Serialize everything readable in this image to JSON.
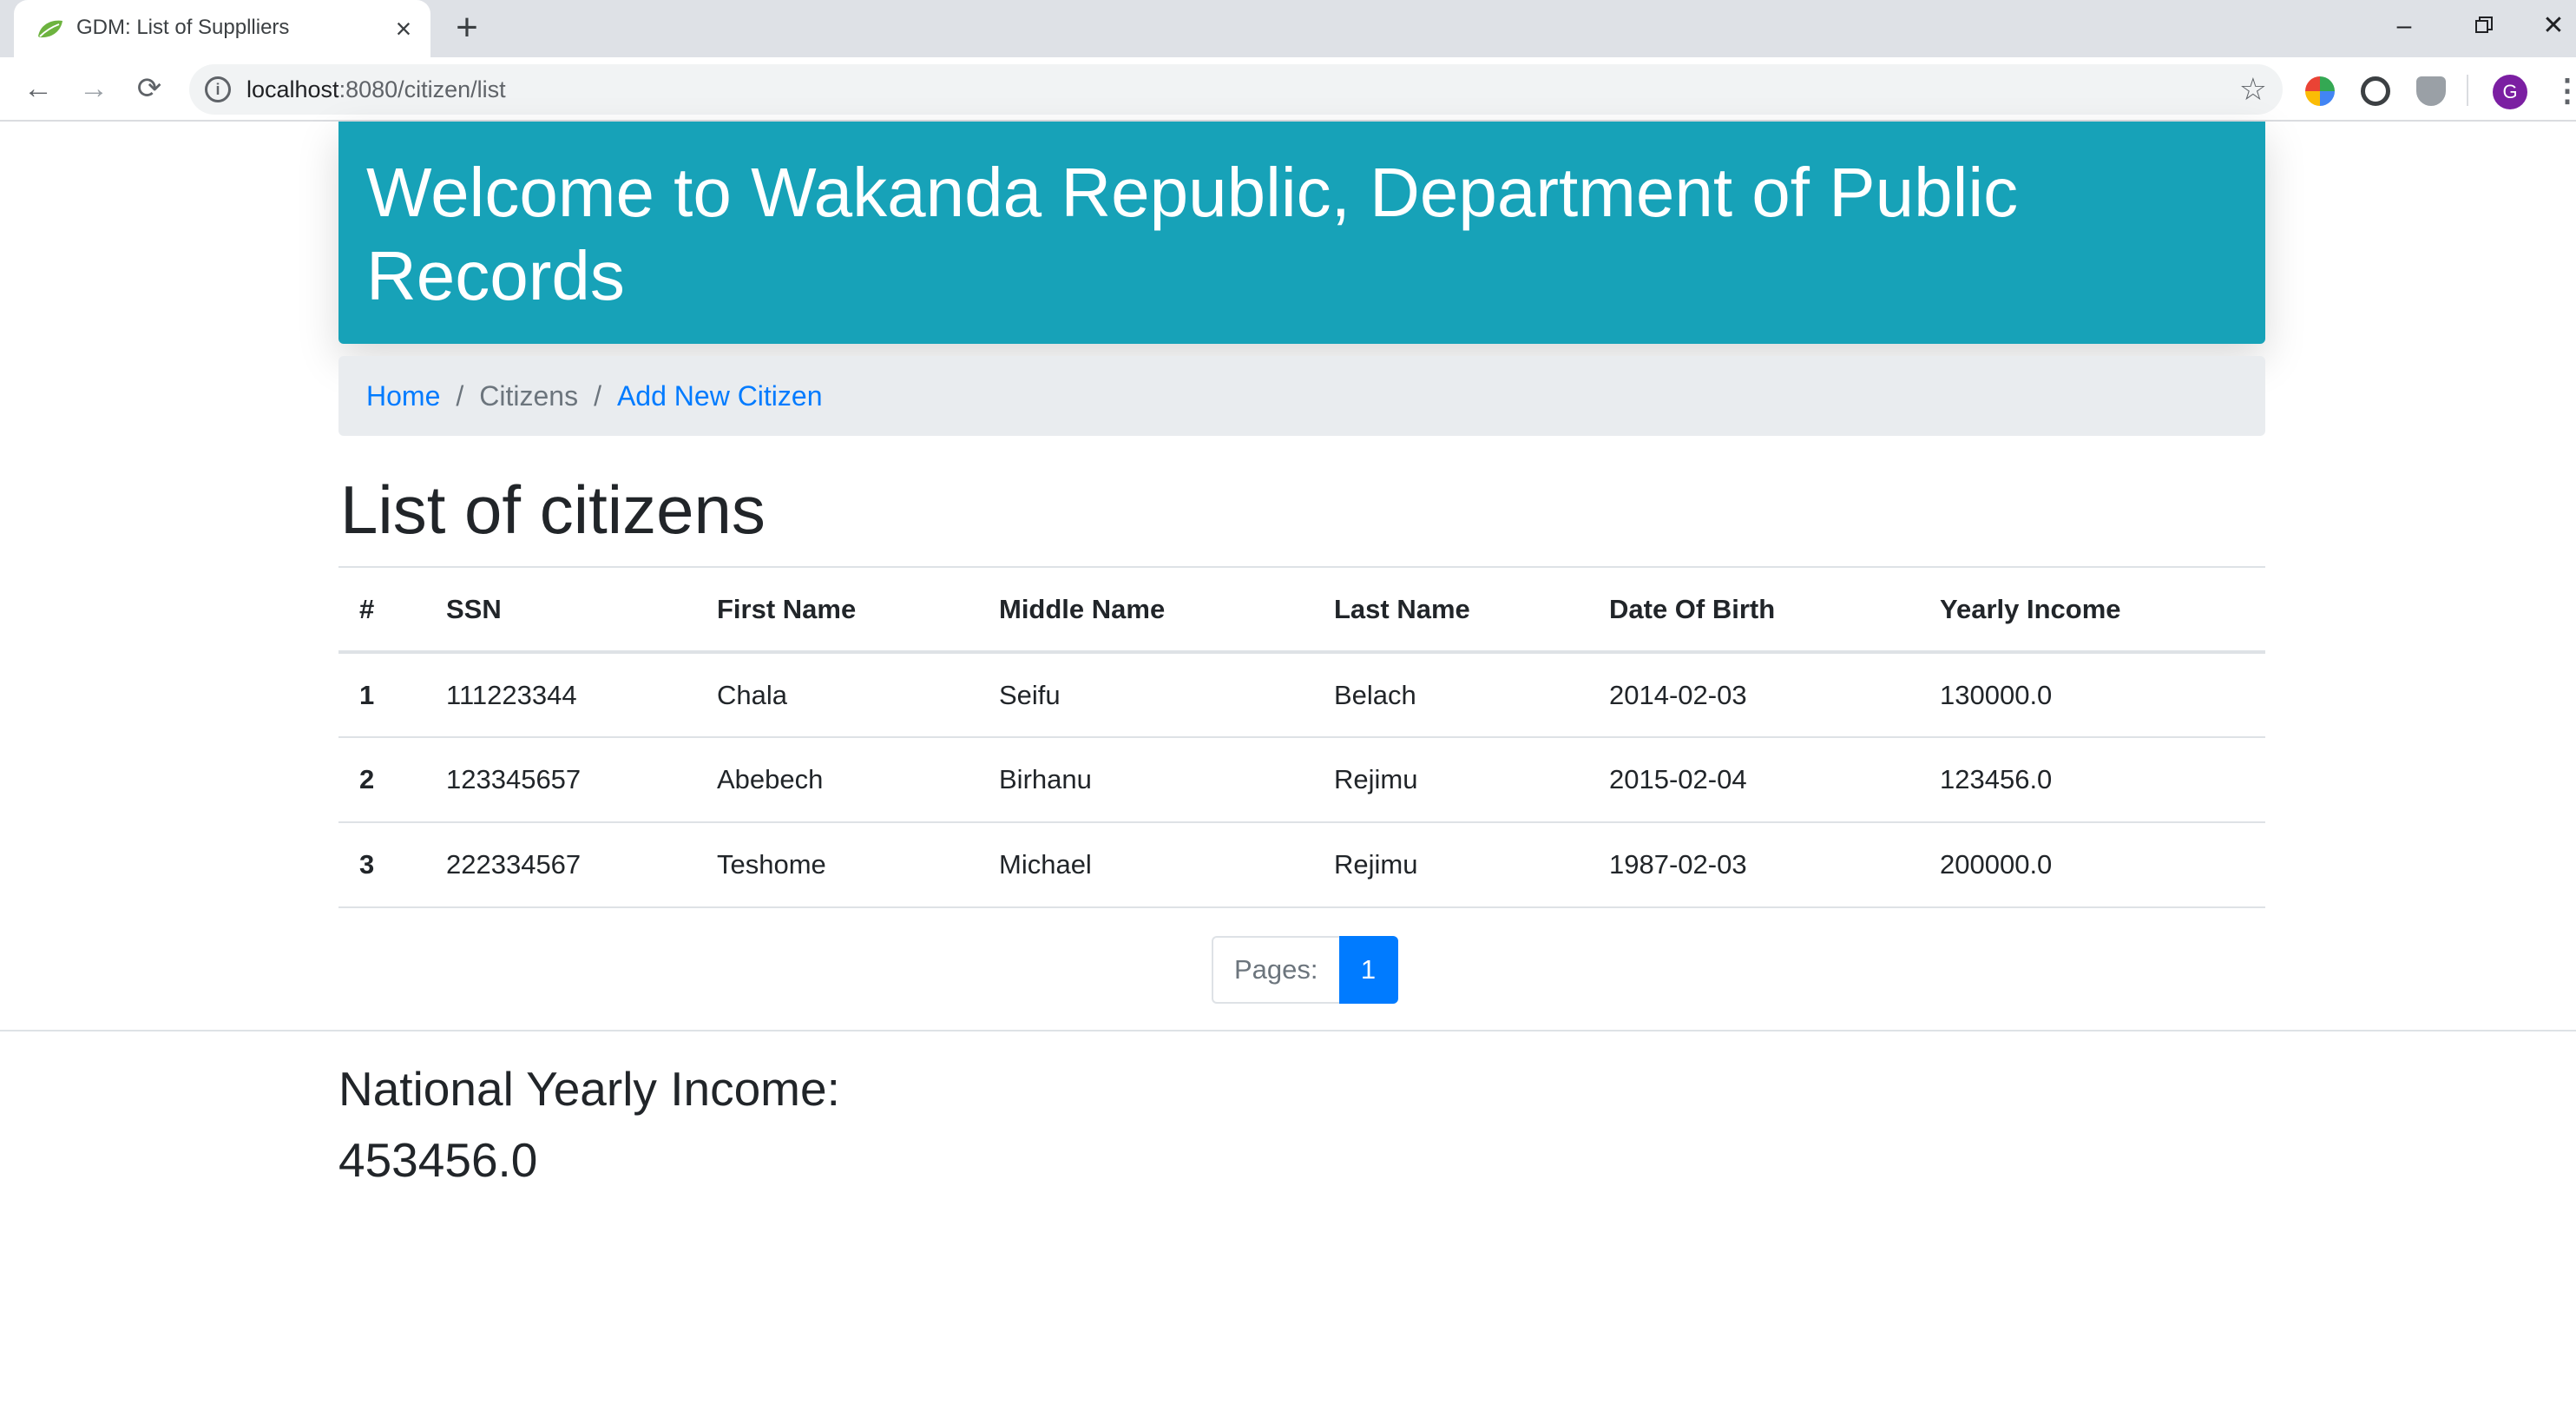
{
  "browser": {
    "tab_title": "GDM: List of Supplliers",
    "url_host": "localhost",
    "url_path": ":8080/citizen/list",
    "avatar_letter": "G"
  },
  "header": {
    "title": "Welcome to Wakanda Republic, Department of Public Records",
    "bg_color": "#17a2b8"
  },
  "breadcrumb": {
    "home": "Home",
    "separator": "/",
    "current": "Citizens",
    "add": "Add New Citizen"
  },
  "main": {
    "title": "List of citizens",
    "columns": [
      "#",
      "SSN",
      "First Name",
      "Middle Name",
      "Last Name",
      "Date Of Birth",
      "Yearly Income"
    ],
    "rows": [
      [
        "1",
        "111223344",
        "Chala",
        "Seifu",
        "Belach",
        "2014-02-03",
        "130000.0"
      ],
      [
        "2",
        "123345657",
        "Abebech",
        "Birhanu",
        "Rejimu",
        "2015-02-04",
        "123456.0"
      ],
      [
        "3",
        "222334567",
        "Teshome",
        "Michael",
        "Rejimu",
        "1987-02-03",
        "200000.0"
      ]
    ],
    "pagination": {
      "label": "Pages:",
      "current": "1"
    }
  },
  "footer": {
    "income_label": "National Yearly Income:",
    "income_value": "453456.0"
  },
  "colors": {
    "primary": "#007bff",
    "info": "#17a2b8"
  }
}
